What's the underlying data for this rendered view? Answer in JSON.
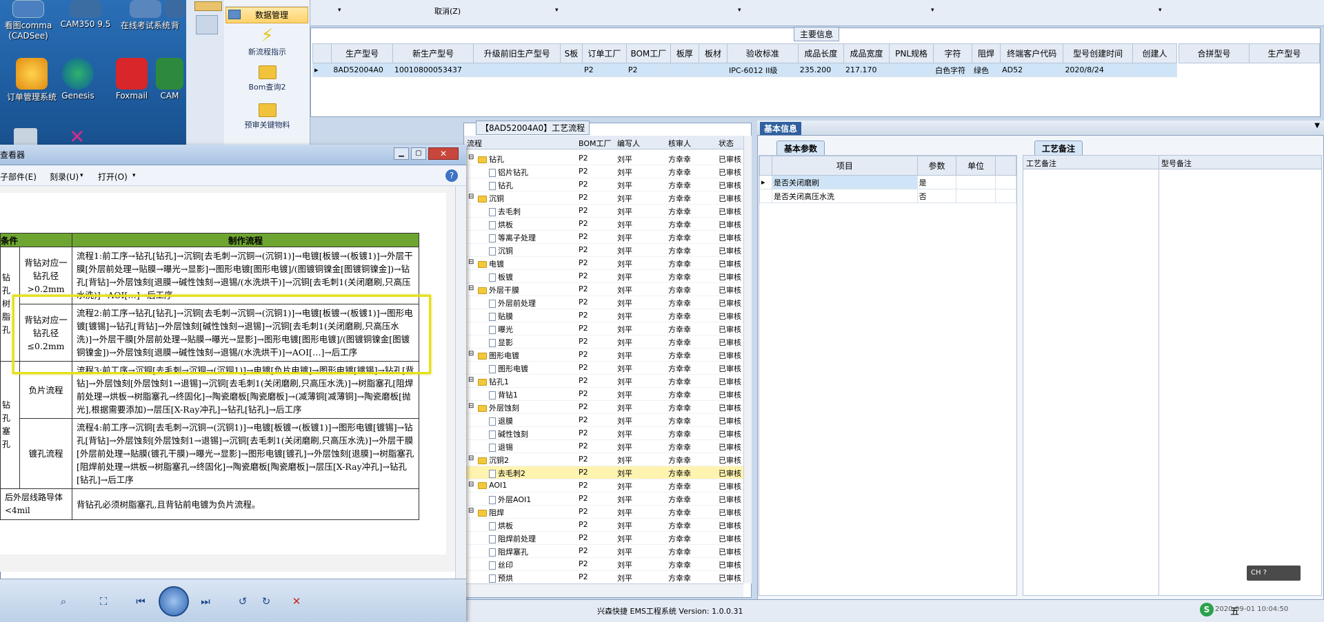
{
  "desktop": {
    "icons": [
      {
        "label": "看图comma"
      },
      {
        "label": "CAM350 9.5"
      },
      {
        "label": "在线考试系统"
      },
      {
        "label": "背"
      },
      {
        "label": "订单管理系统"
      },
      {
        "label": "Genesis"
      },
      {
        "label": "Foxmail"
      },
      {
        "label": "CAM"
      }
    ],
    "icon0_l1": "看图comma",
    "icon0_l2": "(CADSee)"
  },
  "nav": {
    "items": [
      {
        "label": "数据管理"
      },
      {
        "label": "新流程指示"
      },
      {
        "label": "Bom查询2"
      },
      {
        "label": "预审关键物料"
      }
    ]
  },
  "topbar": {
    "cancel": "取消(Z)"
  },
  "main_info": {
    "title": "主要信息",
    "columns": [
      "生产型号",
      "新生产型号",
      "升级前旧生产型号",
      "S板",
      "订单工厂",
      "BOM工厂",
      "板厚",
      "板材",
      "验收标准",
      "成品长度",
      "成品宽度",
      "PNL规格",
      "字符",
      "阻焊",
      "终端客户代码",
      "型号创建时间",
      "创建人"
    ],
    "row": [
      "8AD52004A0",
      "10010800053437",
      "",
      "",
      "P2",
      "P2",
      "",
      "",
      "IPC-6012 II级",
      "235.200",
      "217.170",
      "",
      "白色字符",
      "绿色",
      "AD52",
      "2020/8/24",
      ""
    ],
    "side_cols": [
      "合拼型号",
      "生产型号"
    ]
  },
  "flow": {
    "title": "【8AD52004A0】工艺流程",
    "columns": [
      "流程",
      "BOM工厂",
      "编写人",
      "核审人",
      "状态"
    ],
    "rows": [
      {
        "name": "钻孔",
        "type": "folder",
        "bom": "P2",
        "author": "刘平",
        "reviewer": "方幸幸",
        "status": "已审核"
      },
      {
        "name": "铝片钻孔",
        "type": "doc",
        "bom": "P2",
        "author": "刘平",
        "reviewer": "方幸幸",
        "status": "已审核"
      },
      {
        "name": "钻孔",
        "type": "doc",
        "bom": "P2",
        "author": "刘平",
        "reviewer": "方幸幸",
        "status": "已审核"
      },
      {
        "name": "沉铜",
        "type": "folder",
        "bom": "P2",
        "author": "刘平",
        "reviewer": "方幸幸",
        "status": "已审核"
      },
      {
        "name": "去毛刺",
        "type": "doc",
        "bom": "P2",
        "author": "刘平",
        "reviewer": "方幸幸",
        "status": "已审核"
      },
      {
        "name": "烘板",
        "type": "doc",
        "bom": "P2",
        "author": "刘平",
        "reviewer": "方幸幸",
        "status": "已审核"
      },
      {
        "name": "等离子处理",
        "type": "doc",
        "bom": "P2",
        "author": "刘平",
        "reviewer": "方幸幸",
        "status": "已审核"
      },
      {
        "name": "沉铜",
        "type": "doc",
        "bom": "P2",
        "author": "刘平",
        "reviewer": "方幸幸",
        "status": "已审核"
      },
      {
        "name": "电镀",
        "type": "folder",
        "bom": "P2",
        "author": "刘平",
        "reviewer": "方幸幸",
        "status": "已审核"
      },
      {
        "name": "板镀",
        "type": "doc",
        "bom": "P2",
        "author": "刘平",
        "reviewer": "方幸幸",
        "status": "已审核"
      },
      {
        "name": "外层干膜",
        "type": "folder",
        "bom": "P2",
        "author": "刘平",
        "reviewer": "方幸幸",
        "status": "已审核"
      },
      {
        "name": "外层前处理",
        "type": "doc",
        "bom": "P2",
        "author": "刘平",
        "reviewer": "方幸幸",
        "status": "已审核"
      },
      {
        "name": "贴膜",
        "type": "doc",
        "bom": "P2",
        "author": "刘平",
        "reviewer": "方幸幸",
        "status": "已审核"
      },
      {
        "name": "曝光",
        "type": "doc",
        "bom": "P2",
        "author": "刘平",
        "reviewer": "方幸幸",
        "status": "已审核"
      },
      {
        "name": "显影",
        "type": "doc",
        "bom": "P2",
        "author": "刘平",
        "reviewer": "方幸幸",
        "status": "已审核"
      },
      {
        "name": "图形电镀",
        "type": "folder",
        "bom": "P2",
        "author": "刘平",
        "reviewer": "方幸幸",
        "status": "已审核"
      },
      {
        "name": "图形电镀",
        "type": "doc",
        "bom": "P2",
        "author": "刘平",
        "reviewer": "方幸幸",
        "status": "已审核"
      },
      {
        "name": "钻孔1",
        "type": "folder",
        "bom": "P2",
        "author": "刘平",
        "reviewer": "方幸幸",
        "status": "已审核"
      },
      {
        "name": "背钻1",
        "type": "doc",
        "bom": "P2",
        "author": "刘平",
        "reviewer": "方幸幸",
        "status": "已审核"
      },
      {
        "name": "外层蚀刻",
        "type": "folder",
        "bom": "P2",
        "author": "刘平",
        "reviewer": "方幸幸",
        "status": "已审核"
      },
      {
        "name": "退膜",
        "type": "doc",
        "bom": "P2",
        "author": "刘平",
        "reviewer": "方幸幸",
        "status": "已审核"
      },
      {
        "name": "碱性蚀刻",
        "type": "doc",
        "bom": "P2",
        "author": "刘平",
        "reviewer": "方幸幸",
        "status": "已审核"
      },
      {
        "name": "退锡",
        "type": "doc",
        "bom": "P2",
        "author": "刘平",
        "reviewer": "方幸幸",
        "status": "已审核"
      },
      {
        "name": "沉铜2",
        "type": "folder",
        "bom": "P2",
        "author": "刘平",
        "reviewer": "方幸幸",
        "status": "已审核"
      },
      {
        "name": "去毛刺2",
        "type": "doc",
        "bom": "P2",
        "author": "刘平",
        "reviewer": "方幸幸",
        "status": "已审核",
        "hl": true
      },
      {
        "name": "AOI1",
        "type": "folder",
        "bom": "P2",
        "author": "刘平",
        "reviewer": "方幸幸",
        "status": "已审核"
      },
      {
        "name": "外层AOI1",
        "type": "doc",
        "bom": "P2",
        "author": "刘平",
        "reviewer": "方幸幸",
        "status": "已审核"
      },
      {
        "name": "阻焊",
        "type": "folder",
        "bom": "P2",
        "author": "刘平",
        "reviewer": "方幸幸",
        "status": "已审核"
      },
      {
        "name": "烘板",
        "type": "doc",
        "bom": "P2",
        "author": "刘平",
        "reviewer": "方幸幸",
        "status": "已审核"
      },
      {
        "name": "阻焊前处理",
        "type": "doc",
        "bom": "P2",
        "author": "刘平",
        "reviewer": "方幸幸",
        "status": "已审核"
      },
      {
        "name": "阻焊塞孔",
        "type": "doc",
        "bom": "P2",
        "author": "刘平",
        "reviewer": "方幸幸",
        "status": "已审核"
      },
      {
        "name": "丝印",
        "type": "doc",
        "bom": "P2",
        "author": "刘平",
        "reviewer": "方幸幸",
        "status": "已审核"
      },
      {
        "name": "预烘",
        "type": "doc",
        "bom": "P2",
        "author": "刘平",
        "reviewer": "方幸幸",
        "status": "已审核"
      }
    ]
  },
  "basic": {
    "title": "基本信息",
    "tab1": "基本参数",
    "tab2": "工艺备注",
    "cols": [
      "项目",
      "参数",
      "单位"
    ],
    "rows": [
      {
        "item": "是否关闭磨刷",
        "param": "是"
      },
      {
        "item": "是否关闭高压水洗",
        "param": "否"
      }
    ],
    "note_cols": [
      "工艺备注",
      "型号备注"
    ]
  },
  "viewer": {
    "title": "查看器",
    "menu": [
      "子部件(E)",
      "刻录(U)",
      "打开(O)"
    ],
    "table": {
      "col1": "条件",
      "col2": "制作流程",
      "rows": [
        {
          "cond": "背钻对应一钻孔径>0.2mm",
          "flow": "流程1:前工序→钻孔[钻孔]→沉铜[去毛刺→沉铜→(沉铜1)]→电镀[板镀→(板镀1)]→外层干膜[外层前处理→贴膜→曝光→显影]→图形电镀[图形电镀]/(图镀铜镍金[图镀铜镍金])→钻孔[背钻]→外层蚀刻[退膜→碱性蚀刻→退锡/(水洗烘干)]→沉铜[去毛刺1(关闭磨刷,只高压水洗)]→AOI[…]→后工序"
        },
        {
          "cond": "背钻对应一钻孔径≤0.2mm",
          "flow": "流程2:前工序→钻孔[钻孔]→沉铜[去毛刺→沉铜→(沉铜1)]→电镀[板镀→(板镀1)]→图形电镀[镀锡]→钻孔[背钻]→外层蚀刻[碱性蚀刻→退锡]→沉铜[去毛刺1(关闭磨刷,只高压水洗)]→外层干膜[外层前处理→贴膜→曝光→显影]→图形电镀[图形电镀]/(图镀铜镍金[图镀铜镍金])→外层蚀刻[退膜→碱性蚀刻→退锡/(水洗烘干)]→AOI[…]→后工序"
        },
        {
          "cond": "负片流程",
          "flow": "流程3:前工序→沉铜[去毛刺→沉铜→(沉铜1)]→电镀[负片电镀]→图形电镀[镀锡]→钻孔[背钻]→外层蚀刻[外层蚀刻1→退锡]→沉铜[去毛刺1(关闭磨刷,只高压水洗)]→树脂塞孔[阻焊前处理→烘板→树脂塞孔→终固化]→陶瓷磨板[陶瓷磨板]→(减薄铜[减薄铜]→陶瓷磨板[抛光],根据需要添加)→层压[X-Ray冲孔]→钻孔[钻孔]→后工序"
        },
        {
          "cond": "镀孔流程",
          "flow": "流程4:前工序→沉铜[去毛刺→沉铜→(沉铜1)]→电镀[板镀→(板镀1)]→图形电镀[镀锡]→钻孔[背钻]→外层蚀刻[外层蚀刻1→退锡]→沉铜[去毛刺1(关闭磨刷,只高压水洗)]→外层干膜[外层前处理→贴膜(镀孔干膜)→曝光→显影]→图形电镀[镀孔]→外层蚀刻[退膜]→树脂塞孔[阻焊前处理→烘板→树脂塞孔→终固化]→陶瓷磨板[陶瓷磨板]→层压[X-Ray冲孔]→钻孔[钻孔]→后工序"
        },
        {
          "cond": "后外层线路导体<4mil",
          "flow": "背钻孔必须树脂塞孔,且背钻前电镀为负片流程。"
        }
      ],
      "left_labels": [
        "钻孔",
        "树脂",
        "孔",
        "钻孔",
        "塞",
        "孔"
      ]
    }
  },
  "status": {
    "text": "兴森快捷 EMS工程系统 Version: 1.0.0.31",
    "time": "2020-09-01 10:04:50"
  },
  "tray": {
    "ime": "五",
    "ch": "CH"
  }
}
